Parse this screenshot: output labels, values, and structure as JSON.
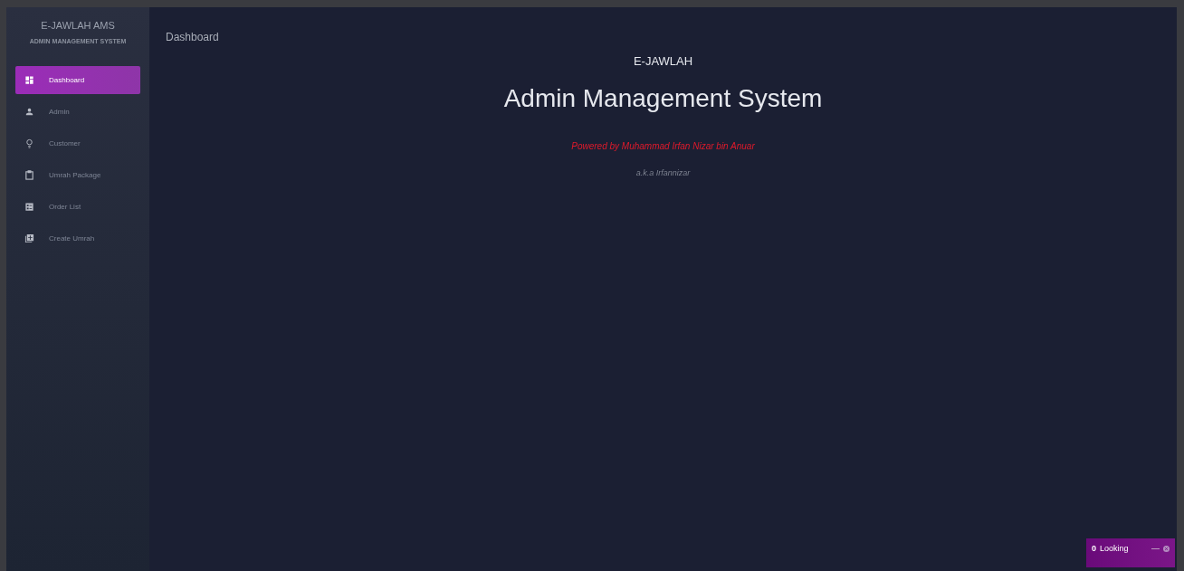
{
  "sidebar": {
    "brand": "E-JAWLAH AMS",
    "subtitle": "ADMIN MANAGEMENT SYSTEM",
    "items": [
      {
        "label": "Dashboard",
        "selected": true
      },
      {
        "label": "Admin",
        "selected": false
      },
      {
        "label": "Customer",
        "selected": false
      },
      {
        "label": "Umrah Package",
        "selected": false
      },
      {
        "label": "Order List",
        "selected": false
      },
      {
        "label": "Create Umrah",
        "selected": false
      }
    ]
  },
  "header": {
    "title": "Dashboard"
  },
  "main": {
    "kicker": "E-JAWLAH",
    "heading": "Admin Management System",
    "powered_by": "Powered by Muhammad Irfan Nizar bin Anuar",
    "alias": "a.k.a Irfannizar"
  },
  "chat_widget": {
    "count": "0",
    "label": "Looking",
    "minimize": "—"
  }
}
